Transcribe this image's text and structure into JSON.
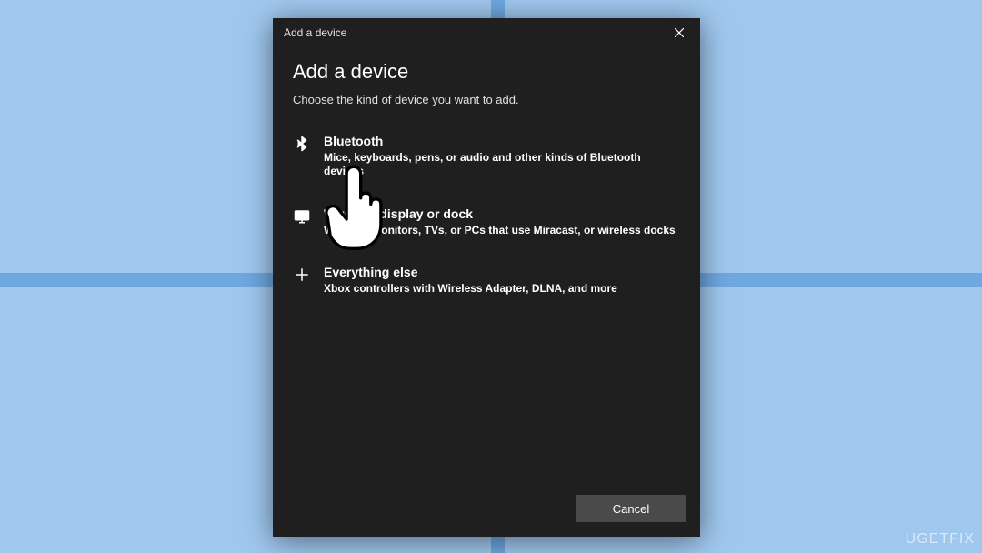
{
  "titlebar": {
    "title": "Add a device"
  },
  "heading": "Add a device",
  "subheading": "Choose the kind of device you want to add.",
  "options": [
    {
      "title": "Bluetooth",
      "desc": "Mice, keyboards, pens, or audio and other kinds of Bluetooth devices"
    },
    {
      "title": "Wireless display or dock",
      "desc": "Wireless monitors, TVs, or PCs that use Miracast, or wireless docks"
    },
    {
      "title": "Everything else",
      "desc": "Xbox controllers with Wireless Adapter, DLNA, and more"
    }
  ],
  "footer": {
    "cancel": "Cancel"
  },
  "watermark": "UGETFIX"
}
